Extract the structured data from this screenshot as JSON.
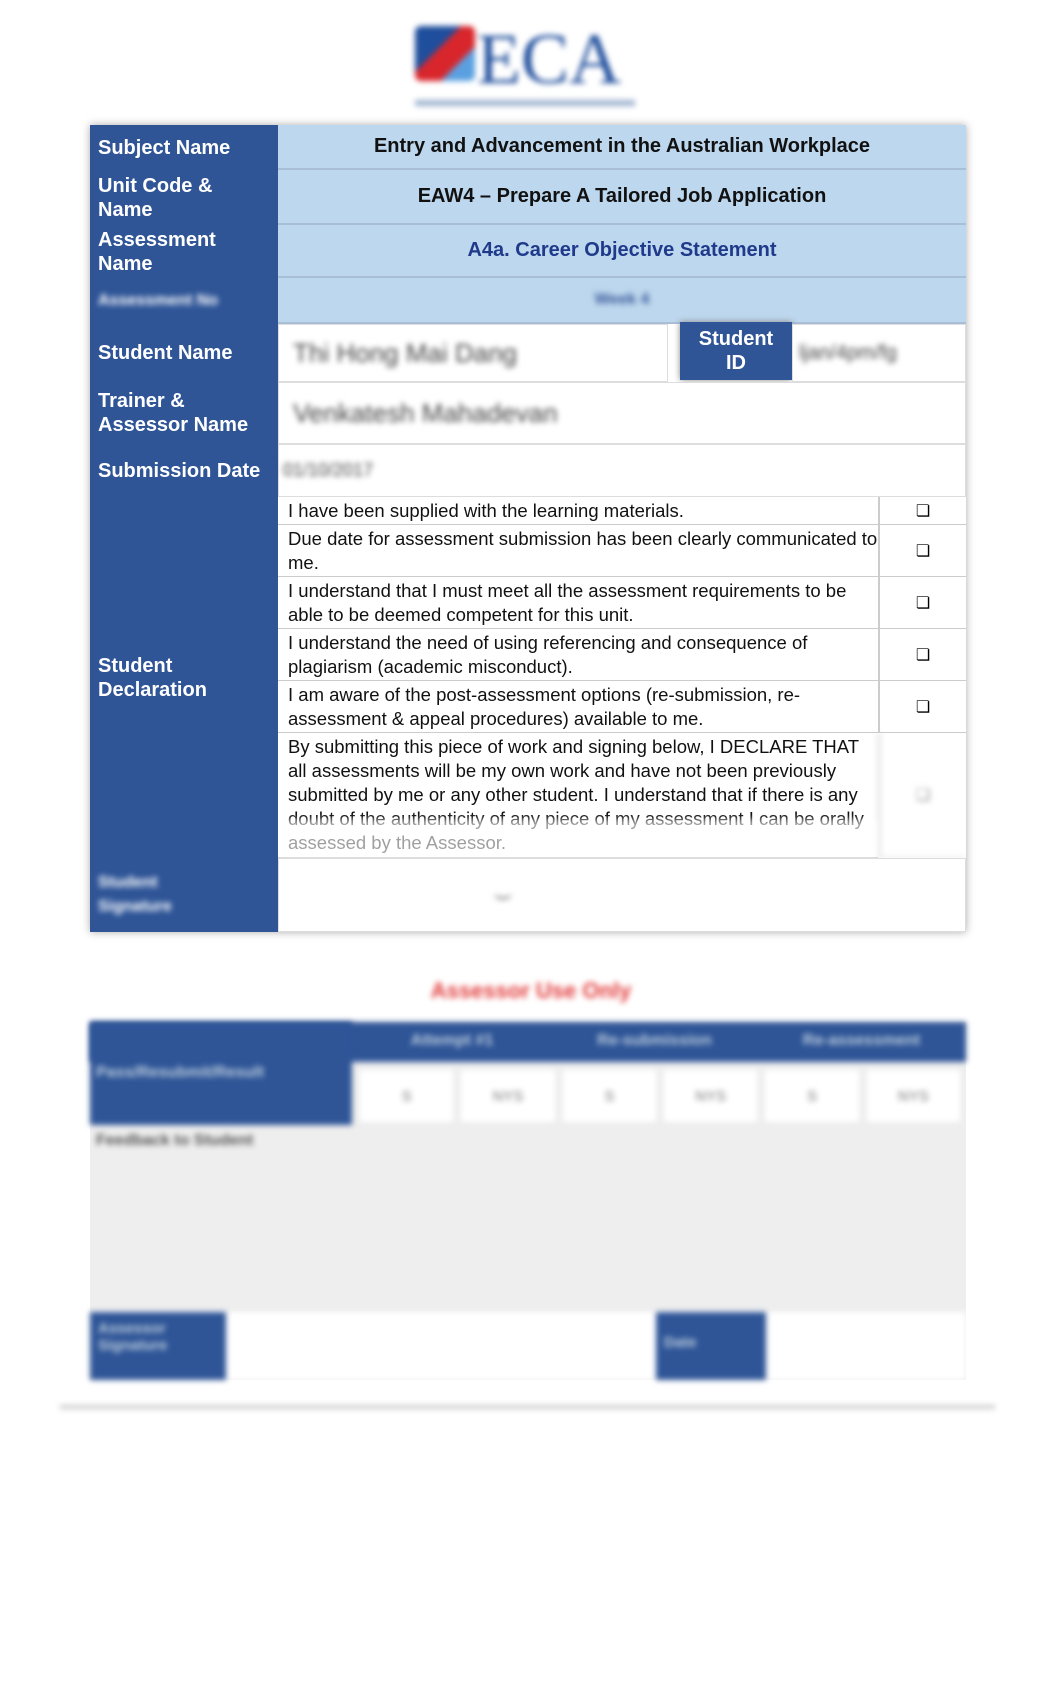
{
  "logo": {
    "text": "ECA"
  },
  "rows": {
    "subject_label": "Subject Name",
    "subject_value": "Entry and Advancement in the Australian Workplace",
    "unit_label": "Unit Code & Name",
    "unit_value": "EAW4 – Prepare A Tailored Job Application",
    "assessment_label": "Assessment Name",
    "assessment_value": "A4a. Career Objective Statement",
    "assessment_no_label": "Assessment No",
    "assessment_no_value": "Week 4",
    "student_name_label": "Student Name",
    "student_name_value": "Thi Hong Mai Dang",
    "student_id_label": "Student ID",
    "student_id_value": "ljan/4pm/fg",
    "trainer_label": "Trainer & Assessor Name",
    "trainer_value": "Venkatesh Mahadevan",
    "submission_label": "Submission Date",
    "submission_value": "01/10/2017",
    "declaration_label": "Student Declaration",
    "signature_label": "Student Signature"
  },
  "declarations": [
    "I have been supplied with the learning materials.",
    "Due date for assessment submission has been clearly communicated to me.",
    "I understand that I must meet all the assessment requirements to be able to be deemed competent for this unit.",
    "I understand the need of using referencing and consequence of plagiarism (academic misconduct).",
    "I am aware of the post-assessment options (re-submission, re-assessment & appeal procedures) available to me.",
    "By submitting this piece of work and signing below, I DECLARE THAT all assessments will be my own work and have not been previously submitted by me or any other student. I understand that if there is any doubt of the authenticity of any piece of my assessment I can be orally assessed by the Assessor."
  ],
  "checkbox_glyph": "❏",
  "assessor": {
    "title": "Assessor Use Only",
    "row_label": "Pass/Resubmit/Result",
    "columns": [
      "Attempt #1",
      "Re-submission",
      "Re-assessment"
    ],
    "options": [
      "S",
      "NYS"
    ],
    "feedback_label": "Feedback to Student",
    "signature_label": "Assessor Signature",
    "date_label": "Date"
  },
  "colors": {
    "header_blue": "#2f5597",
    "light_blue": "#bdd7ee",
    "title_red": "#e23b3b"
  }
}
